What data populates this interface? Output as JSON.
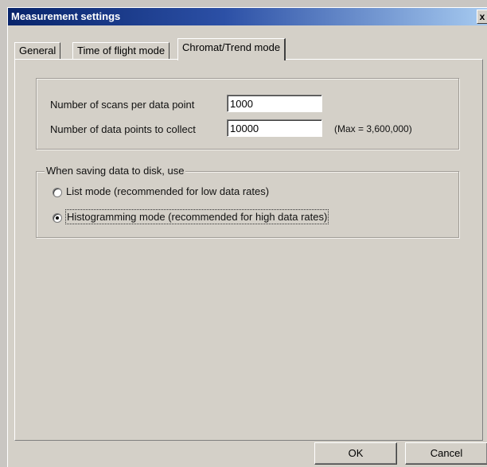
{
  "window": {
    "title": "Measurement settings",
    "close_label": "x"
  },
  "tabs": [
    {
      "label": "General",
      "active": false
    },
    {
      "label": "Time of flight mode",
      "active": false
    },
    {
      "label": "Chromat/Trend mode",
      "active": true
    }
  ],
  "settings": {
    "scans_label": "Number of scans per data point",
    "scans_value": "1000",
    "points_label": "Number of data points to collect",
    "points_value": "10000",
    "points_note": "(Max = 3,600,000)"
  },
  "saving": {
    "group_label": "When saving data to disk, use",
    "options": [
      {
        "label": "List mode (recommended for low data rates)",
        "selected": false
      },
      {
        "label": "Histogramming mode (recommended for high data rates)",
        "selected": true
      }
    ]
  },
  "buttons": {
    "ok_label": "OK",
    "cancel_label": "Cancel"
  }
}
